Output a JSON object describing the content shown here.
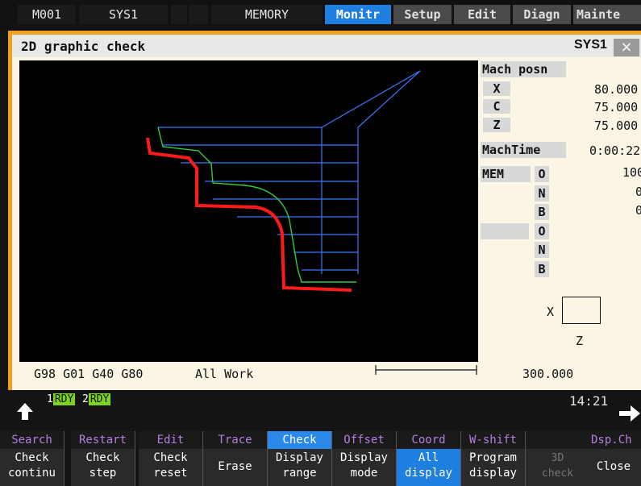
{
  "topbar": {
    "tabs": [
      {
        "label": "M001"
      },
      {
        "label": "SYS1"
      },
      {
        "label": ""
      },
      {
        "label": ""
      },
      {
        "label": "MEMORY"
      },
      {
        "label": "Monitr"
      },
      {
        "label": "Setup"
      },
      {
        "label": "Edit"
      },
      {
        "label": "Diagn"
      },
      {
        "label": "Mainte"
      }
    ]
  },
  "window": {
    "title": "2D graphic check",
    "system": "SYS1",
    "close_glyph": "×"
  },
  "graph": {
    "modal_text": "G98 G01 G40 G80",
    "view_text": "All Work",
    "scale_value": "300.000",
    "colors": {
      "workpiece": "#ff1a1a",
      "path": "#33cc33",
      "rapid": "#3a78ff"
    }
  },
  "position": {
    "header": "Mach posn",
    "axes": [
      {
        "name": "X",
        "value": "80.000"
      },
      {
        "name": "C",
        "value": "75.000"
      },
      {
        "name": "Z",
        "value": "75.000"
      }
    ],
    "machtime_label": "MachTime",
    "machtime_value": "0:00:22"
  },
  "program": {
    "mode": "MEM",
    "row1": [
      {
        "code": "O",
        "value": "100"
      },
      {
        "code": "N",
        "value": "0"
      },
      {
        "code": "B",
        "value": "0"
      }
    ],
    "row2": [
      {
        "code": "O",
        "value": ""
      },
      {
        "code": "N",
        "value": ""
      },
      {
        "code": "B",
        "value": ""
      }
    ]
  },
  "axis_indicator": {
    "x": "X",
    "z": "Z"
  },
  "status": {
    "ch1": "1",
    "ch1_state": "RDY",
    "ch2": "2",
    "ch2_state": "RDY",
    "time": "14:21"
  },
  "softkeys": [
    {
      "top": "Search",
      "bottom1": "Check",
      "bottom2": "continu"
    },
    {
      "top": "Restart",
      "bottom1": "Check",
      "bottom2": "step"
    },
    {
      "top": "Edit",
      "bottom1": "Check",
      "bottom2": "reset"
    },
    {
      "top": "Trace",
      "bottom1": "Erase",
      "bottom2": ""
    },
    {
      "top": "Check",
      "bottom1": "Display",
      "bottom2": "range"
    },
    {
      "top": "Offset",
      "bottom1": "Display",
      "bottom2": "mode"
    },
    {
      "top": "Coord",
      "bottom1": "All",
      "bottom2": "display"
    },
    {
      "top": "W-shift",
      "bottom1": "Program",
      "bottom2": "display"
    },
    {
      "top": "",
      "bottom1": "3D",
      "bottom2": "check"
    },
    {
      "top": "Dsp.Ch",
      "bottom1": "Close",
      "bottom2": ""
    }
  ]
}
